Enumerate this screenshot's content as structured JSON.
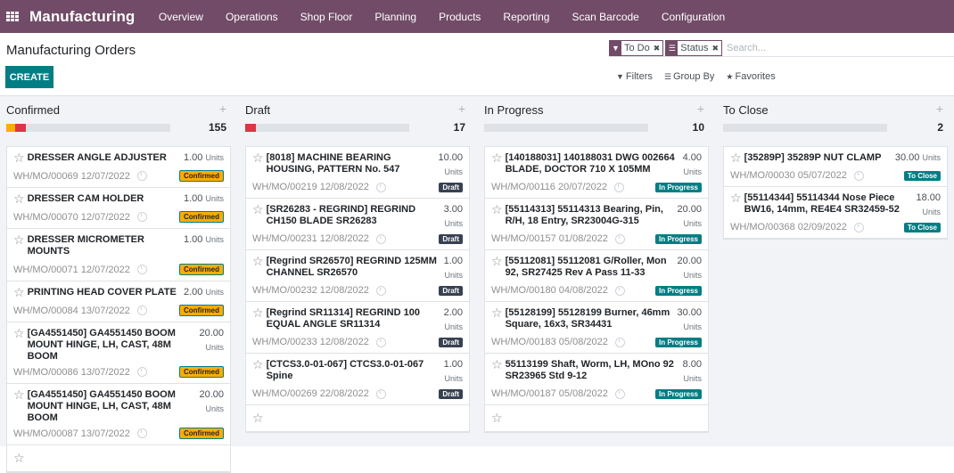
{
  "navbar": {
    "brand": "Manufacturing",
    "items": [
      "Overview",
      "Operations",
      "Shop Floor",
      "Planning",
      "Products",
      "Reporting",
      "Scan Barcode",
      "Configuration"
    ]
  },
  "control_panel": {
    "title": "Manufacturing Orders",
    "create_label": "CREATE",
    "search": {
      "facets": [
        {
          "icon": "filter-icon",
          "value": "To Do"
        },
        {
          "icon": "group-by-icon",
          "value": "Status"
        }
      ],
      "placeholder": "Search..."
    },
    "filters_label": "Filters",
    "group_by_label": "Group By",
    "favorites_label": "Favorites"
  },
  "colors": {
    "brand": "#714B67",
    "primary": "#017E84",
    "warning": "#FFAC00",
    "danger": "#DC3545"
  },
  "columns": [
    {
      "title": "Confirmed",
      "count": "155",
      "progress": [
        {
          "color": "#FFAC00",
          "fraction": 0.054
        },
        {
          "color": "#DC3545",
          "fraction": 0.065
        }
      ],
      "cards": [
        {
          "title": "DRESSER ANGLE ADJUSTER",
          "qty": "1.00",
          "unit": "Units",
          "ref": "WH/MO/00069 12/07/2022",
          "status": "Confirmed"
        },
        {
          "title": "DRESSER CAM HOLDER",
          "qty": "1.00",
          "unit": "Units",
          "ref": "WH/MO/00070 12/07/2022",
          "status": "Confirmed"
        },
        {
          "title": "DRESSER MICROMETER MOUNTS",
          "qty": "1.00",
          "unit": "Units",
          "ref": "WH/MO/00071 12/07/2022",
          "status": "Confirmed"
        },
        {
          "title": "PRINTING HEAD COVER PLATE",
          "qty": "2.00",
          "unit": "Units",
          "ref": "WH/MO/00084 13/07/2022",
          "status": "Confirmed"
        },
        {
          "title": "[GA4551450] GA4551450 BOOM MOUNT HINGE, LH, CAST, 48M BOOM",
          "qty": "20.00",
          "unit": "Units",
          "ref": "WH/MO/00086 13/07/2022",
          "status": "Confirmed"
        },
        {
          "title": "[GA4551450] GA4551450 BOOM MOUNT HINGE, LH, CAST, 48M BOOM",
          "qty": "20.00",
          "unit": "Units",
          "ref": "WH/MO/00087 13/07/2022",
          "status": "Confirmed"
        }
      ]
    },
    {
      "title": "Draft",
      "count": "17",
      "progress": [
        {
          "color": "#DC3545",
          "fraction": 0.065
        }
      ],
      "cards": [
        {
          "title": "[8018] MACHINE BEARING HOUSING, PATTERN No. 547",
          "qty": "10.00",
          "unit": "Units",
          "ref": "WH/MO/00219 12/08/2022",
          "status": "Draft"
        },
        {
          "title": "[SR26283 - REGRIND] REGRIND CH150 BLADE SR26283",
          "qty": "3.00",
          "unit": "Units",
          "ref": "WH/MO/00231 12/08/2022",
          "status": "Draft"
        },
        {
          "title": "[Regrind SR26570] REGRIND 125MM CHANNEL SR26570",
          "qty": "1.00",
          "unit": "Units",
          "ref": "WH/MO/00232 12/08/2022",
          "status": "Draft"
        },
        {
          "title": "[Regrind SR11314] REGRIND 100 EQUAL ANGLE SR11314",
          "qty": "2.00",
          "unit": "Units",
          "ref": "WH/MO/00233 12/08/2022",
          "status": "Draft"
        },
        {
          "title": "[CTCS3.0-01-067] CTCS3.0-01-067 Spine",
          "qty": "1.00",
          "unit": "Units",
          "ref": "WH/MO/00269 22/08/2022",
          "status": "Draft"
        }
      ]
    },
    {
      "title": "In Progress",
      "count": "10",
      "progress": [],
      "cards": [
        {
          "title": "[140188031] 140188031 DWG 002664 BLADE, DOCTOR 710 X 105MM",
          "qty": "4.00",
          "unit": "Units",
          "ref": "WH/MO/00116 20/07/2022",
          "status": "In Progress"
        },
        {
          "title": "[55114313] 55114313 Bearing, Pin, R/H, 18 Entry, SR23004G-315",
          "qty": "20.00",
          "unit": "Units",
          "ref": "WH/MO/00157 01/08/2022",
          "status": "In Progress"
        },
        {
          "title": "[55112081] 55112081 G/Roller, Mon 92, SR27425 Rev A Pass 11-33",
          "qty": "20.00",
          "unit": "Units",
          "ref": "WH/MO/00180 04/08/2022",
          "status": "In Progress"
        },
        {
          "title": "[55128199] 55128199 Burner, 46mm Square, 16x3, SR34431",
          "qty": "30.00",
          "unit": "Units",
          "ref": "WH/MO/00183 05/08/2022",
          "status": "In Progress"
        },
        {
          "title": "55113199 Shaft, Worm, LH, MOno 92 SR23965 Std 9-12",
          "qty": "8.00",
          "unit": "Units",
          "ref": "WH/MO/00187 05/08/2022",
          "status": "In Progress"
        }
      ]
    },
    {
      "title": "To Close",
      "count": "2",
      "progress": [],
      "cards": [
        {
          "title": "[35289P] 35289P NUT CLAMP",
          "qty": "30.00",
          "unit": "Units",
          "ref": "WH/MO/00030 05/07/2022",
          "status": "To Close"
        },
        {
          "title": "[55114344] 55114344 Nose Piece BW16, 14mm, RE4E4 SR32459-52",
          "qty": "18.00",
          "unit": "Units",
          "ref": "WH/MO/00368 02/09/2022",
          "status": "To Close"
        }
      ]
    }
  ]
}
